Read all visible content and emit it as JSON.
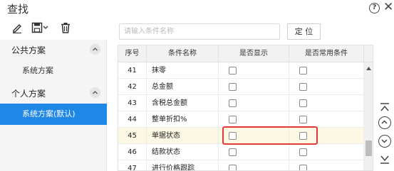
{
  "window": {
    "title": "查找",
    "help_label": "?",
    "close_label": "✕"
  },
  "toolbar": {
    "icons": [
      "edit-icon",
      "save-icon",
      "delete-icon"
    ]
  },
  "sidebar": {
    "groups": [
      {
        "title": "公共方案",
        "items": [
          {
            "label": "系统方案",
            "active": false
          }
        ]
      },
      {
        "title": "个人方案",
        "items": [
          {
            "label": "系统方案(默认)",
            "active": true
          }
        ]
      }
    ]
  },
  "search": {
    "placeholder": "请输入条件名称",
    "value": ""
  },
  "locate_button": {
    "label": "定 位"
  },
  "table": {
    "columns": [
      "序号",
      "条件名称",
      "是否显示",
      "是否常用条件"
    ],
    "rows": [
      {
        "no": "41",
        "name": "抹零",
        "show": false,
        "common": false
      },
      {
        "no": "42",
        "name": "总金额",
        "show": false,
        "common": false
      },
      {
        "no": "43",
        "name": "含税总金额",
        "show": false,
        "common": false
      },
      {
        "no": "44",
        "name": "整单折扣%",
        "show": false,
        "common": false
      },
      {
        "no": "45",
        "name": "单据状态",
        "show": false,
        "common": false,
        "highlighted": true
      },
      {
        "no": "46",
        "name": "结款状态",
        "show": false,
        "common": false
      },
      {
        "no": "47",
        "name": "进行价格跟踪",
        "show": false,
        "common": false
      }
    ]
  },
  "colors": {
    "accent": "#1f87e6",
    "highlight_row": "#fdf8e4",
    "annotation": "#e53935"
  }
}
